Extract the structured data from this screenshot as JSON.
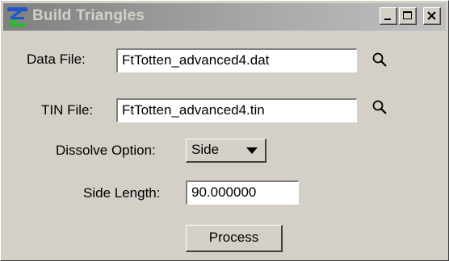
{
  "window": {
    "title": "Build Triangles",
    "app_icon": "bentley-b-icon",
    "controls": [
      "minimize-icon",
      "maximize-icon",
      "close-icon"
    ]
  },
  "form": {
    "data_file_label": "Data File:",
    "data_file_value": "FtTotten_advanced4.dat",
    "tin_file_label": "TIN File:",
    "tin_file_value": "FtTotten_advanced4.tin",
    "browse_icon": "search-icon",
    "dissolve_label": "Dissolve Option:",
    "dissolve_value": "Side",
    "side_length_label": "Side Length:",
    "side_length_value": "90.000000",
    "process_label": "Process"
  },
  "colors": {
    "face": "#d4d0c8",
    "title_gradient_start": "#808080",
    "title_gradient_end": "#c0c0c0",
    "icon_blue": "#1f57c8",
    "icon_green": "#2eb82e"
  }
}
